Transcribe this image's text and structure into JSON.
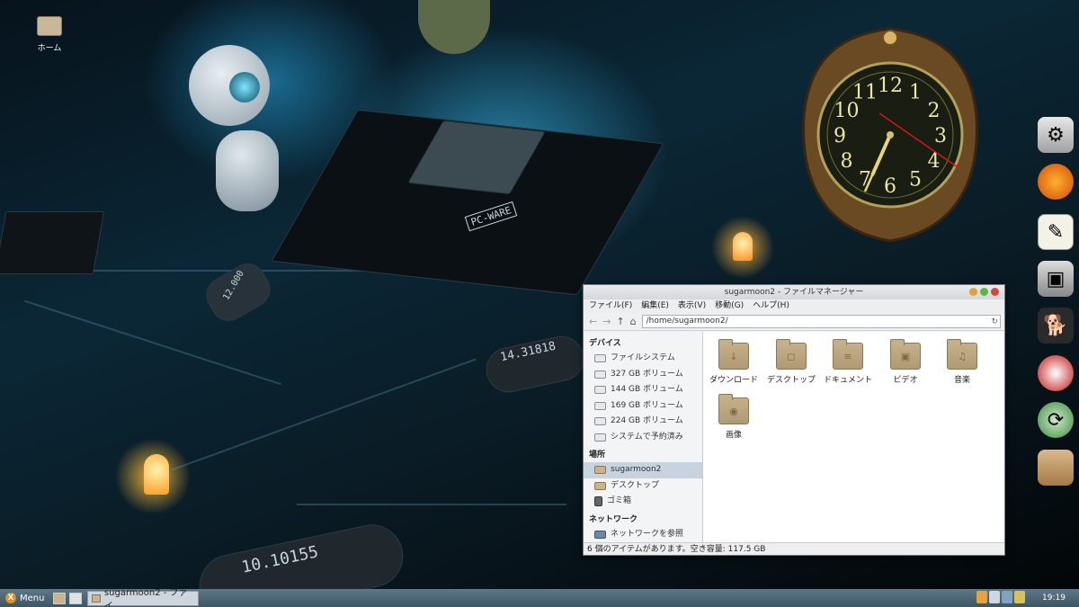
{
  "desktop": {
    "home_icon_label": "ホーム",
    "pcb_texts": {
      "ware": "PC-WARE",
      "osc1": "14.31818",
      "osc2": "10.10155",
      "osc3": "12.000"
    }
  },
  "clock": {
    "numerals": [
      "12",
      "1",
      "2",
      "3",
      "4",
      "5",
      "6",
      "7",
      "8",
      "9",
      "10",
      "11"
    ]
  },
  "dock": {
    "icons": [
      "system-tools-icon",
      "firefox-icon",
      "text-editor-icon",
      "screenshot-icon",
      "gimp-icon",
      "media-player-icon",
      "update-icon",
      "archive-icon"
    ]
  },
  "file_manager": {
    "title": "sugarmoon2 - ファイルマネージャー",
    "menu": [
      "ファイル(F)",
      "編集(E)",
      "表示(V)",
      "移動(G)",
      "ヘルプ(H)"
    ],
    "address": "/home/sugarmoon2/",
    "sidebar": {
      "devices_header": "デバイス",
      "devices": [
        "ファイルシステム",
        "327 GB ボリューム",
        "144 GB ボリューム",
        "169 GB ボリューム",
        "224 GB ボリューム",
        "システムで予約済み"
      ],
      "places_header": "場所",
      "places": [
        "sugarmoon2",
        "デスクトップ",
        "ゴミ箱"
      ],
      "network_header": "ネットワーク",
      "network": [
        "ネットワークを参照"
      ]
    },
    "items": [
      {
        "label": "ダウンロード",
        "glyph": "↓"
      },
      {
        "label": "デスクトップ",
        "glyph": "◻"
      },
      {
        "label": "ドキュメント",
        "glyph": "≡"
      },
      {
        "label": "ビデオ",
        "glyph": "▣"
      },
      {
        "label": "音楽",
        "glyph": "♫"
      },
      {
        "label": "画像",
        "glyph": "◉"
      }
    ],
    "status": "6 個のアイテムがあります。空き容量: 117.5 GB"
  },
  "taskbar": {
    "menu_label": "Menu",
    "task_label": "sugarmoon2 - ファイ...",
    "clock_time": "19:19"
  }
}
